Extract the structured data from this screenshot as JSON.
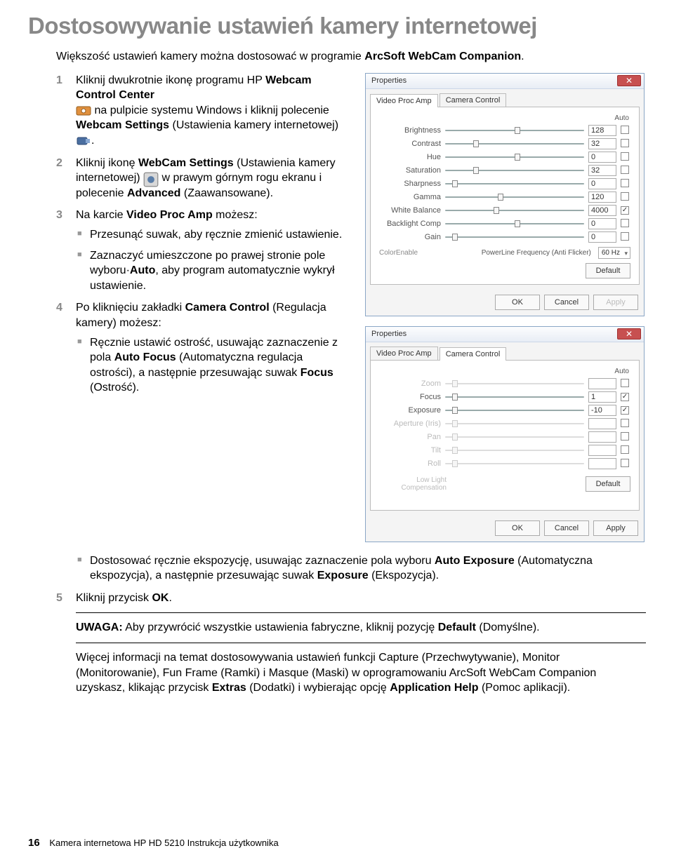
{
  "title": "Dostosowywanie ustawień kamery internetowej",
  "intro_pre": "Większość ustawień kamery można dostosować w programie ",
  "intro_b": "ArcSoft WebCam Companion",
  "intro_post": ".",
  "steps": {
    "s1": {
      "num": "1",
      "a": "Kliknij dwukrotnie ikonę programu HP ",
      "b1": "Webcam Control Center",
      "c": " na pulpicie systemu Windows i kliknij polecenie ",
      "b2": "Webcam Settings",
      "d": " (Ustawienia kamery internetowej) ",
      "e": "."
    },
    "s2": {
      "num": "2",
      "a": "Kliknij ikonę ",
      "b1": "WebCam Settings",
      "c": " (Ustawienia kamery internetowej) ",
      "d": " w prawym górnym rogu ekranu i polecenie ",
      "b2": "Advanced",
      "e": " (Zaawansowane)."
    },
    "s3": {
      "num": "3",
      "a": "Na karcie ",
      "b1": "Video Proc Amp",
      "c": " możesz:",
      "sub1": "Przesunąć suwak, aby ręcznie zmienić ustawienie.",
      "sub2_a": "Zaznaczyć umieszczone po prawej stronie pole wyboru·",
      "sub2_b": "Auto",
      "sub2_c": ", aby program automatycznie wykrył ustawienie."
    },
    "s4": {
      "num": "4",
      "a": "Po kliknięciu zakładki ",
      "b1": "Camera Control",
      "c": " (Regulacja kamery) możesz:",
      "sub1_a": "Ręcznie ustawić ostrość, usuwając zaznaczenie z pola ",
      "sub1_b": "Auto Focus",
      "sub1_c": " (Automatyczna regulacja ostrości), a następnie przesuwając suwak ",
      "sub1_d": "Focus",
      "sub1_e": " (Ostrość).",
      "sub2_a": "Dostosować ręcznie ekspozycję, usuwając zaznaczenie pola wyboru ",
      "sub2_b": "Auto Exposure",
      "sub2_c": " (Automatyczna ekspozycja), a następnie przesuwając suwak ",
      "sub2_d": "Exposure",
      "sub2_e": " (Ekspozycja)."
    },
    "s5": {
      "num": "5",
      "a": "Kliknij przycisk ",
      "b1": "OK",
      "c": "."
    }
  },
  "note": {
    "a": "UWAGA:",
    "b": " Aby przywrócić wszystkie ustawienia fabryczne, kliknij pozycję ",
    "c": "Default",
    "d": " (Domyślne)."
  },
  "more": {
    "a": "Więcej informacji na temat dostosowywania ustawień funkcji Capture (Przechwytywanie), Monitor (Monitorowanie), Fun Frame (Ramki) i Masque (Maski) w oprogramowaniu ArcSoft WebCam Companion uzyskasz, klikając przycisk ",
    "b1": "Extras",
    "c": " (Dodatki) i wybierając opcję ",
    "b2": "Application Help",
    "d": " (Pomoc aplikacji)."
  },
  "footer": {
    "page": "16",
    "text": "Kamera internetowa HP HD 5210 Instrukcja użytkownika"
  },
  "dlg1": {
    "title": "Properties",
    "tabs": [
      "Video Proc Amp",
      "Camera Control"
    ],
    "auto": "Auto",
    "rows": [
      {
        "label": "Brightness",
        "val": "128",
        "auto": false,
        "pos": 50
      },
      {
        "label": "Contrast",
        "val": "32",
        "auto": false,
        "pos": 20
      },
      {
        "label": "Hue",
        "val": "0",
        "auto": false,
        "pos": 50
      },
      {
        "label": "Saturation",
        "val": "32",
        "auto": false,
        "pos": 20
      },
      {
        "label": "Sharpness",
        "val": "0",
        "auto": false,
        "pos": 5
      },
      {
        "label": "Gamma",
        "val": "120",
        "auto": false,
        "pos": 38
      },
      {
        "label": "White Balance",
        "val": "4000",
        "auto": true,
        "pos": 35
      },
      {
        "label": "Backlight Comp",
        "val": "0",
        "auto": false,
        "pos": 50
      },
      {
        "label": "Gain",
        "val": "0",
        "auto": false,
        "pos": 5
      }
    ],
    "colorenable": "ColorEnable",
    "plf": "PowerLine Frequency (Anti Flicker)",
    "plf_val": "60 Hz",
    "default": "Default",
    "ok": "OK",
    "cancel": "Cancel",
    "apply": "Apply"
  },
  "dlg2": {
    "title": "Properties",
    "tabs": [
      "Video Proc Amp",
      "Camera Control"
    ],
    "auto": "Auto",
    "rows": [
      {
        "label": "Zoom",
        "val": "",
        "auto": false,
        "pos": 5,
        "dis": true
      },
      {
        "label": "Focus",
        "val": "1",
        "auto": true,
        "pos": 5,
        "dis": false
      },
      {
        "label": "Exposure",
        "val": "-10",
        "auto": true,
        "pos": 5,
        "dis": false
      },
      {
        "label": "Aperture (Iris)",
        "val": "",
        "auto": false,
        "pos": 5,
        "dis": true
      },
      {
        "label": "Pan",
        "val": "",
        "auto": false,
        "pos": 5,
        "dis": true
      },
      {
        "label": "Tilt",
        "val": "",
        "auto": false,
        "pos": 5,
        "dis": true
      },
      {
        "label": "Roll",
        "val": "",
        "auto": false,
        "pos": 5,
        "dis": true
      }
    ],
    "llc": "Low Light Compensation",
    "default": "Default",
    "ok": "OK",
    "cancel": "Cancel",
    "apply": "Apply"
  }
}
